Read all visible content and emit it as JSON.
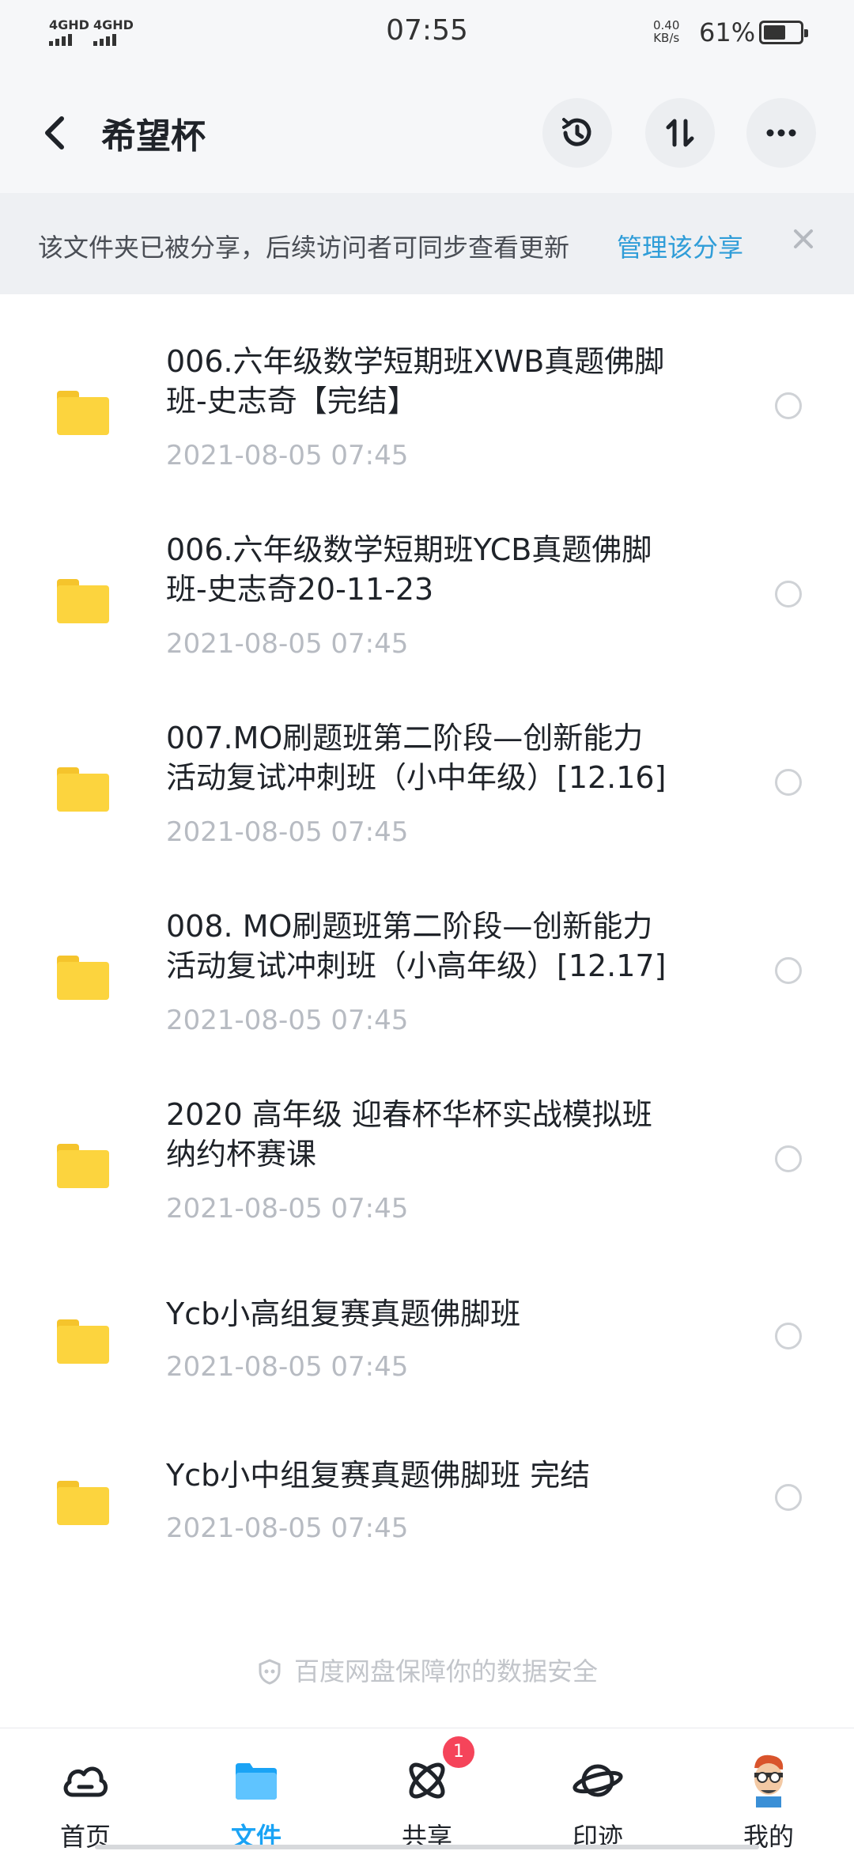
{
  "status_bar": {
    "signal1_label": "4GHD",
    "signal2_label": "4GHD",
    "time": "07:55",
    "net_speed_value": "0.40",
    "net_speed_unit": "KB/s",
    "battery_percent": "61%",
    "battery_level": 0.61
  },
  "header": {
    "title": "希望杯",
    "back_icon": "chevron-left-icon",
    "history_icon": "history-icon",
    "sort_icon": "sort-icon",
    "more_icon": "more-icon"
  },
  "banner": {
    "text": "该文件夹已被分享，后续访问者可同步查看更新",
    "link": "管理该分享",
    "close_icon": "close-icon"
  },
  "files": [
    {
      "name_line1": "006.六年级数学短期班XWB真题佛脚",
      "name_line2": "班-史志奇【完结】",
      "date": "2021-08-05  07:45"
    },
    {
      "name_line1": "006.六年级数学短期班YCB真题佛脚",
      "name_line2": "班-史志奇20-11-23",
      "date": "2021-08-05  07:45"
    },
    {
      "name_line1": "007.MO刷题班第二阶段—创新能力",
      "name_line2": "活动复试冲刺班（小中年级）[12.16]",
      "date": "2021-08-05  07:45"
    },
    {
      "name_line1": "008. MO刷题班第二阶段—创新能力",
      "name_line2": "活动复试冲刺班（小高年级）[12.17]",
      "date": "2021-08-05  07:45"
    },
    {
      "name_line1": "2020 高年级 迎春杯华杯实战模拟班",
      "name_line2": "纳约杯赛课",
      "date": "2021-08-05  07:45"
    },
    {
      "name_line1": "Ycb小高组复赛真题佛脚班",
      "name_line2": "",
      "date": "2021-08-05  07:45"
    },
    {
      "name_line1": "Ycb小中组复赛真题佛脚班 完结",
      "name_line2": "",
      "date": "2021-08-05  07:45"
    }
  ],
  "footer_note": "百度网盘保障你的数据安全",
  "bottom_nav": {
    "items": [
      {
        "label": "首页",
        "icon": "cloud-icon"
      },
      {
        "label": "文件",
        "icon": "folder-icon"
      },
      {
        "label": "共享",
        "icon": "atom-icon",
        "badge": "1"
      },
      {
        "label": "印迹",
        "icon": "planet-icon"
      },
      {
        "label": "我的",
        "icon": "avatar"
      }
    ],
    "active_index": 1
  },
  "colors": {
    "accent": "#1aa3f5",
    "link": "#2f9dd8",
    "folder": "#fcd43e",
    "badge": "#f5445a"
  }
}
